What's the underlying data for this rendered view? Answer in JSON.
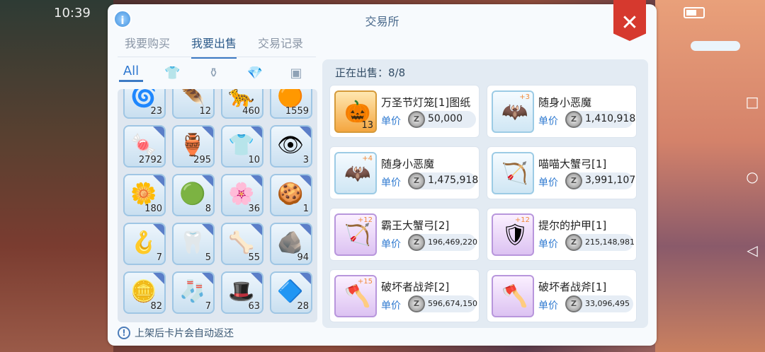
{
  "status": {
    "time": "10:39"
  },
  "panel": {
    "title": "交易所",
    "close_label": "✕",
    "info_label": "i"
  },
  "tabs": [
    {
      "label": "我要购买"
    },
    {
      "label": "我要出售"
    },
    {
      "label": "交易记录"
    }
  ],
  "categories": [
    {
      "label": "All",
      "icon": "all-text"
    },
    {
      "label": "👕",
      "icon": "shirt-icon"
    },
    {
      "label": "⚱",
      "icon": "potion-icon"
    },
    {
      "label": "💎",
      "icon": "gem-icon"
    },
    {
      "label": "▣",
      "icon": "card-icon"
    }
  ],
  "inventory": [
    {
      "glyph": "🌀",
      "count": "23"
    },
    {
      "glyph": "🪶",
      "count": "12"
    },
    {
      "glyph": "🐆",
      "count": "460"
    },
    {
      "glyph": "🟠",
      "count": "1559"
    },
    {
      "glyph": "🍬",
      "count": "2792"
    },
    {
      "glyph": "🏺",
      "count": "295"
    },
    {
      "glyph": "👕",
      "count": "10"
    },
    {
      "glyph": "👁",
      "count": "3"
    },
    {
      "glyph": "🌼",
      "count": "180"
    },
    {
      "glyph": "🟢",
      "count": "8"
    },
    {
      "glyph": "🌸",
      "count": "36"
    },
    {
      "glyph": "🍪",
      "count": "1"
    },
    {
      "glyph": "🪝",
      "count": "7"
    },
    {
      "glyph": "🦷",
      "count": "5"
    },
    {
      "glyph": "🦴",
      "count": "55"
    },
    {
      "glyph": "🪨",
      "count": "94"
    },
    {
      "glyph": "🪙",
      "count": "82"
    },
    {
      "glyph": "🧦",
      "count": "7"
    },
    {
      "glyph": "🎩",
      "count": "63"
    },
    {
      "glyph": "🔷",
      "count": "28"
    }
  ],
  "note": "上架后卡片会自动返还",
  "selling": {
    "label": "正在出售：8/8"
  },
  "price_label": "单价",
  "listings": [
    {
      "name": "万圣节灯笼[1]图纸",
      "price": "50,000",
      "glyph": "🎃",
      "count": "13",
      "level": ""
    },
    {
      "name": "随身小恶魔",
      "price": "1,410,918",
      "glyph": "🦇",
      "count": "",
      "level": "+3"
    },
    {
      "name": "随身小恶魔",
      "price": "1,475,918",
      "glyph": "🦇",
      "count": "",
      "level": "+4"
    },
    {
      "name": "喵喵大蟹弓[1]",
      "price": "3,991,107",
      "glyph": "🏹",
      "count": "",
      "level": ""
    },
    {
      "name": "霸王大蟹弓[2]",
      "price": "196,469,220",
      "glyph": "🏹",
      "count": "",
      "level": "+12"
    },
    {
      "name": "提尔的护甲[1]",
      "price": "215,148,981",
      "glyph": "🛡",
      "count": "",
      "level": "+12"
    },
    {
      "name": "破坏者战斧[2]",
      "price": "596,674,150",
      "glyph": "🪓",
      "count": "",
      "level": "+15"
    },
    {
      "name": "破坏者战斧[1]",
      "price": "33,096,495",
      "glyph": "🪓",
      "count": "",
      "level": ""
    }
  ]
}
